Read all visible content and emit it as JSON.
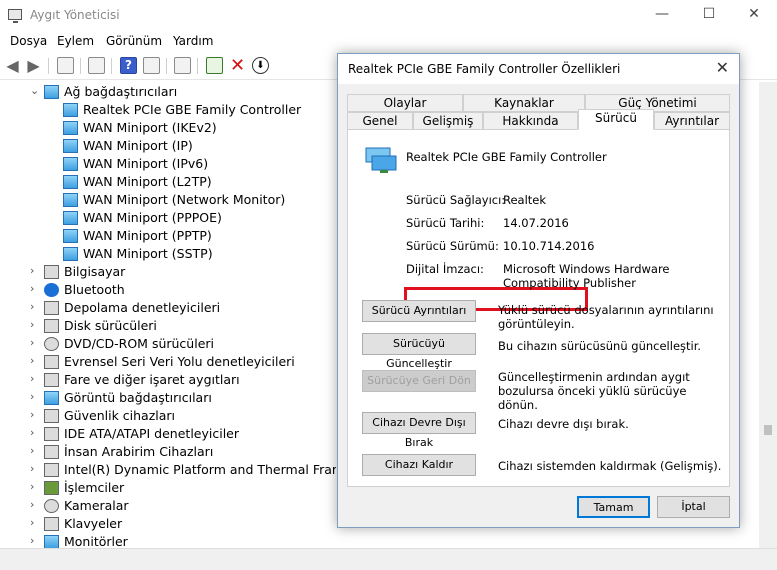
{
  "window": {
    "title": "Aygıt Yöneticisi",
    "min": "—",
    "max": "☐",
    "close": "✕"
  },
  "menu": [
    "Dosya",
    "Eylem",
    "Görünüm",
    "Yardım"
  ],
  "tree": {
    "expanded_category": "Ağ bağdaştırıcıları",
    "network_devices": [
      "Realtek PCIe GBE Family Controller",
      "WAN Miniport (IKEv2)",
      "WAN Miniport (IP)",
      "WAN Miniport (IPv6)",
      "WAN Miniport (L2TP)",
      "WAN Miniport (Network Monitor)",
      "WAN Miniport (PPPOE)",
      "WAN Miniport (PPTP)",
      "WAN Miniport (SSTP)"
    ],
    "categories": [
      "Bilgisayar",
      "Bluetooth",
      "Depolama denetleyicileri",
      "Disk sürücüleri",
      "DVD/CD-ROM sürücüleri",
      "Evrensel Seri Veri Yolu denetleyicileri",
      "Fare ve diğer işaret aygıtları",
      "Görüntü bağdaştırıcıları",
      "Güvenlik cihazları",
      "IDE ATA/ATAPI denetleyiciler",
      "İnsan Arabirim Cihazları",
      "Intel(R) Dynamic Platform and Thermal Framework",
      "İşlemciler",
      "Kameralar",
      "Klavyeler",
      "Monitörler"
    ]
  },
  "dialog": {
    "title": "Realtek PCIe GBE Family Controller Özellikleri",
    "tabs_top": [
      "Olaylar",
      "Kaynaklar",
      "Güç Yönetimi"
    ],
    "tabs_bottom": [
      "Genel",
      "Gelişmiş",
      "Hakkında",
      "Sürücü",
      "Ayrıntılar"
    ],
    "active_tab": "Sürücü",
    "device_name": "Realtek PCIe GBE Family Controller",
    "fields": {
      "provider_label": "Sürücü Sağlayıcı:",
      "provider_value": "Realtek",
      "date_label": "Sürücü Tarihi:",
      "date_value": "14.07.2016",
      "version_label": "Sürücü Sürümü:",
      "version_value": "10.10.714.2016",
      "signer_label": "Dijital İmzacı:",
      "signer_value": "Microsoft Windows Hardware Compatibility Publisher"
    },
    "actions": [
      {
        "button": "Sürücü Ayrıntıları",
        "desc": "Yüklü sürücü dosyalarının ayrıntılarını görüntüleyin.",
        "enabled": true
      },
      {
        "button": "Sürücüyü Güncelleştir",
        "desc": "Bu cihazın sürücüsünü güncelleştir.",
        "enabled": true
      },
      {
        "button": "Sürücüye Geri Dön",
        "desc": "Güncelleştirmenin ardından aygıt bozulursa önceki yüklü sürücüye dönün.",
        "enabled": false
      },
      {
        "button": "Cihazı Devre Dışı Bırak",
        "desc": "Cihazı devre dışı bırak.",
        "enabled": true
      },
      {
        "button": "Cihazı Kaldır",
        "desc": "Cihazı sistemden kaldırmak (Gelişmiş).",
        "enabled": true
      }
    ],
    "ok_label": "Tamam",
    "cancel_label": "İptal",
    "close_label": "✕"
  },
  "colors": {
    "highlight": "#e0101e",
    "accent": "#0078d7"
  }
}
